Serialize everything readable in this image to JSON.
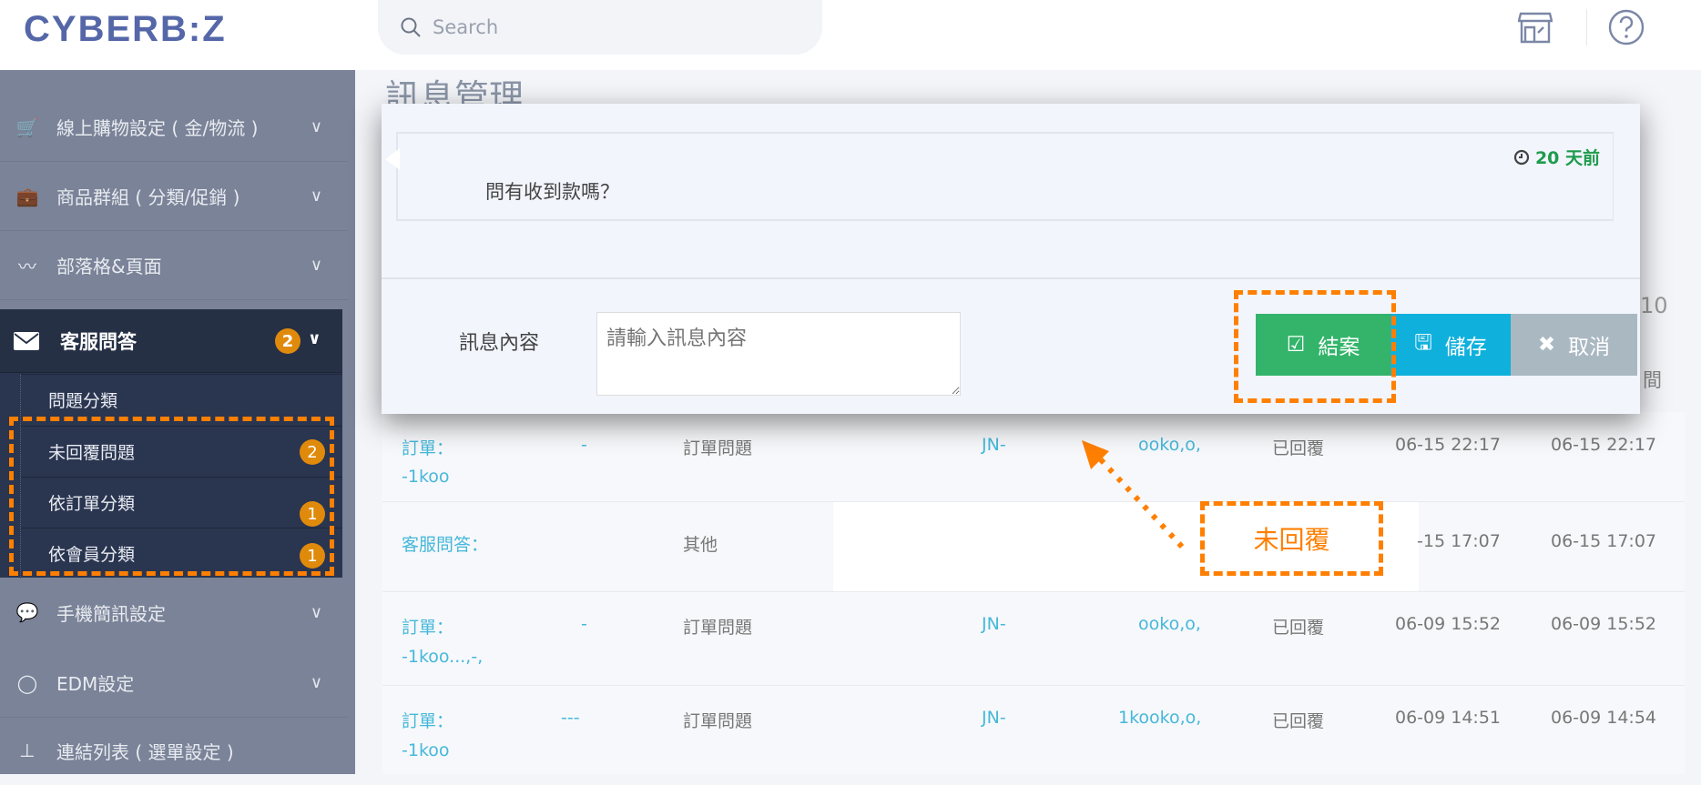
{
  "header": {
    "logo": "CYBERB:Z",
    "search_placeholder": "Search",
    "icons": [
      "store-icon",
      "help-icon"
    ]
  },
  "page_title": "訊息管理",
  "sidebar": {
    "items": [
      {
        "label": "線上購物設定 ( 金/物流 )",
        "icon": "cart-icon"
      },
      {
        "label": "商品群組 ( 分類/促銷 )",
        "icon": "briefcase-icon"
      },
      {
        "label": "部落格&頁面",
        "icon": "rss-icon"
      }
    ],
    "active": {
      "label": "客服問答",
      "icon": "envelope-icon",
      "badge": "2",
      "sub": [
        {
          "label": "問題分類",
          "badge": ""
        },
        {
          "label": "未回覆問題",
          "badge": "2"
        },
        {
          "label": "依訂單分類",
          "badge": "1"
        },
        {
          "label": "依會員分類",
          "badge": "1"
        }
      ]
    },
    "items_after": [
      {
        "label": "手機簡訊設定",
        "icon": "comment-icon"
      },
      {
        "label": "EDM設定",
        "icon": "comment-outline-icon"
      },
      {
        "label": "連結列表 ( 選單設定 )",
        "icon": "sitemap-icon"
      }
    ]
  },
  "modal": {
    "time_ago": "20 天前",
    "message": "問有收到款嗎？",
    "content_label": "訊息內容",
    "content_placeholder": "請輸入訊息內容",
    "buttons": {
      "close_case": "結案",
      "save": "儲存",
      "cancel": "取消"
    },
    "colors": {
      "close_case": "#33b46a",
      "save": "#0fb0dc",
      "cancel": "#aab8c2",
      "time": "#1e9b4c"
    }
  },
  "background": {
    "partial_count": "10",
    "partial_header": "間"
  },
  "table": {
    "rows": [
      {
        "subject": "訂單：",
        "subject2": "-1koo",
        "col2": "-",
        "type": "訂單問題",
        "order": "JN-",
        "member": "ooko,o,",
        "status": "已回覆",
        "created": "06-15 22:17",
        "updated": "06-15 22:17"
      },
      {
        "subject": "客服問答：",
        "subject2": "",
        "col2": "",
        "type": "其他",
        "order": "",
        "member": "",
        "status": "",
        "created": "-15 17:07",
        "updated": "06-15 17:07"
      },
      {
        "subject": "訂單：",
        "subject2": "-1koo...,-,",
        "col2": "-",
        "type": "訂單問題",
        "order": "JN-",
        "member": "ooko,o,",
        "status": "已回覆",
        "created": "06-09 15:52",
        "updated": "06-09 15:52"
      },
      {
        "subject": "訂單：",
        "subject2": "-1koo",
        "col2": "---",
        "type": "訂單問題",
        "order": "JN-",
        "member": "1kooko,o,",
        "status": "已回覆",
        "created": "06-09 14:51",
        "updated": "06-09 14:54"
      }
    ]
  },
  "annotation": {
    "label": "未回覆",
    "color": "#ff7f00"
  }
}
